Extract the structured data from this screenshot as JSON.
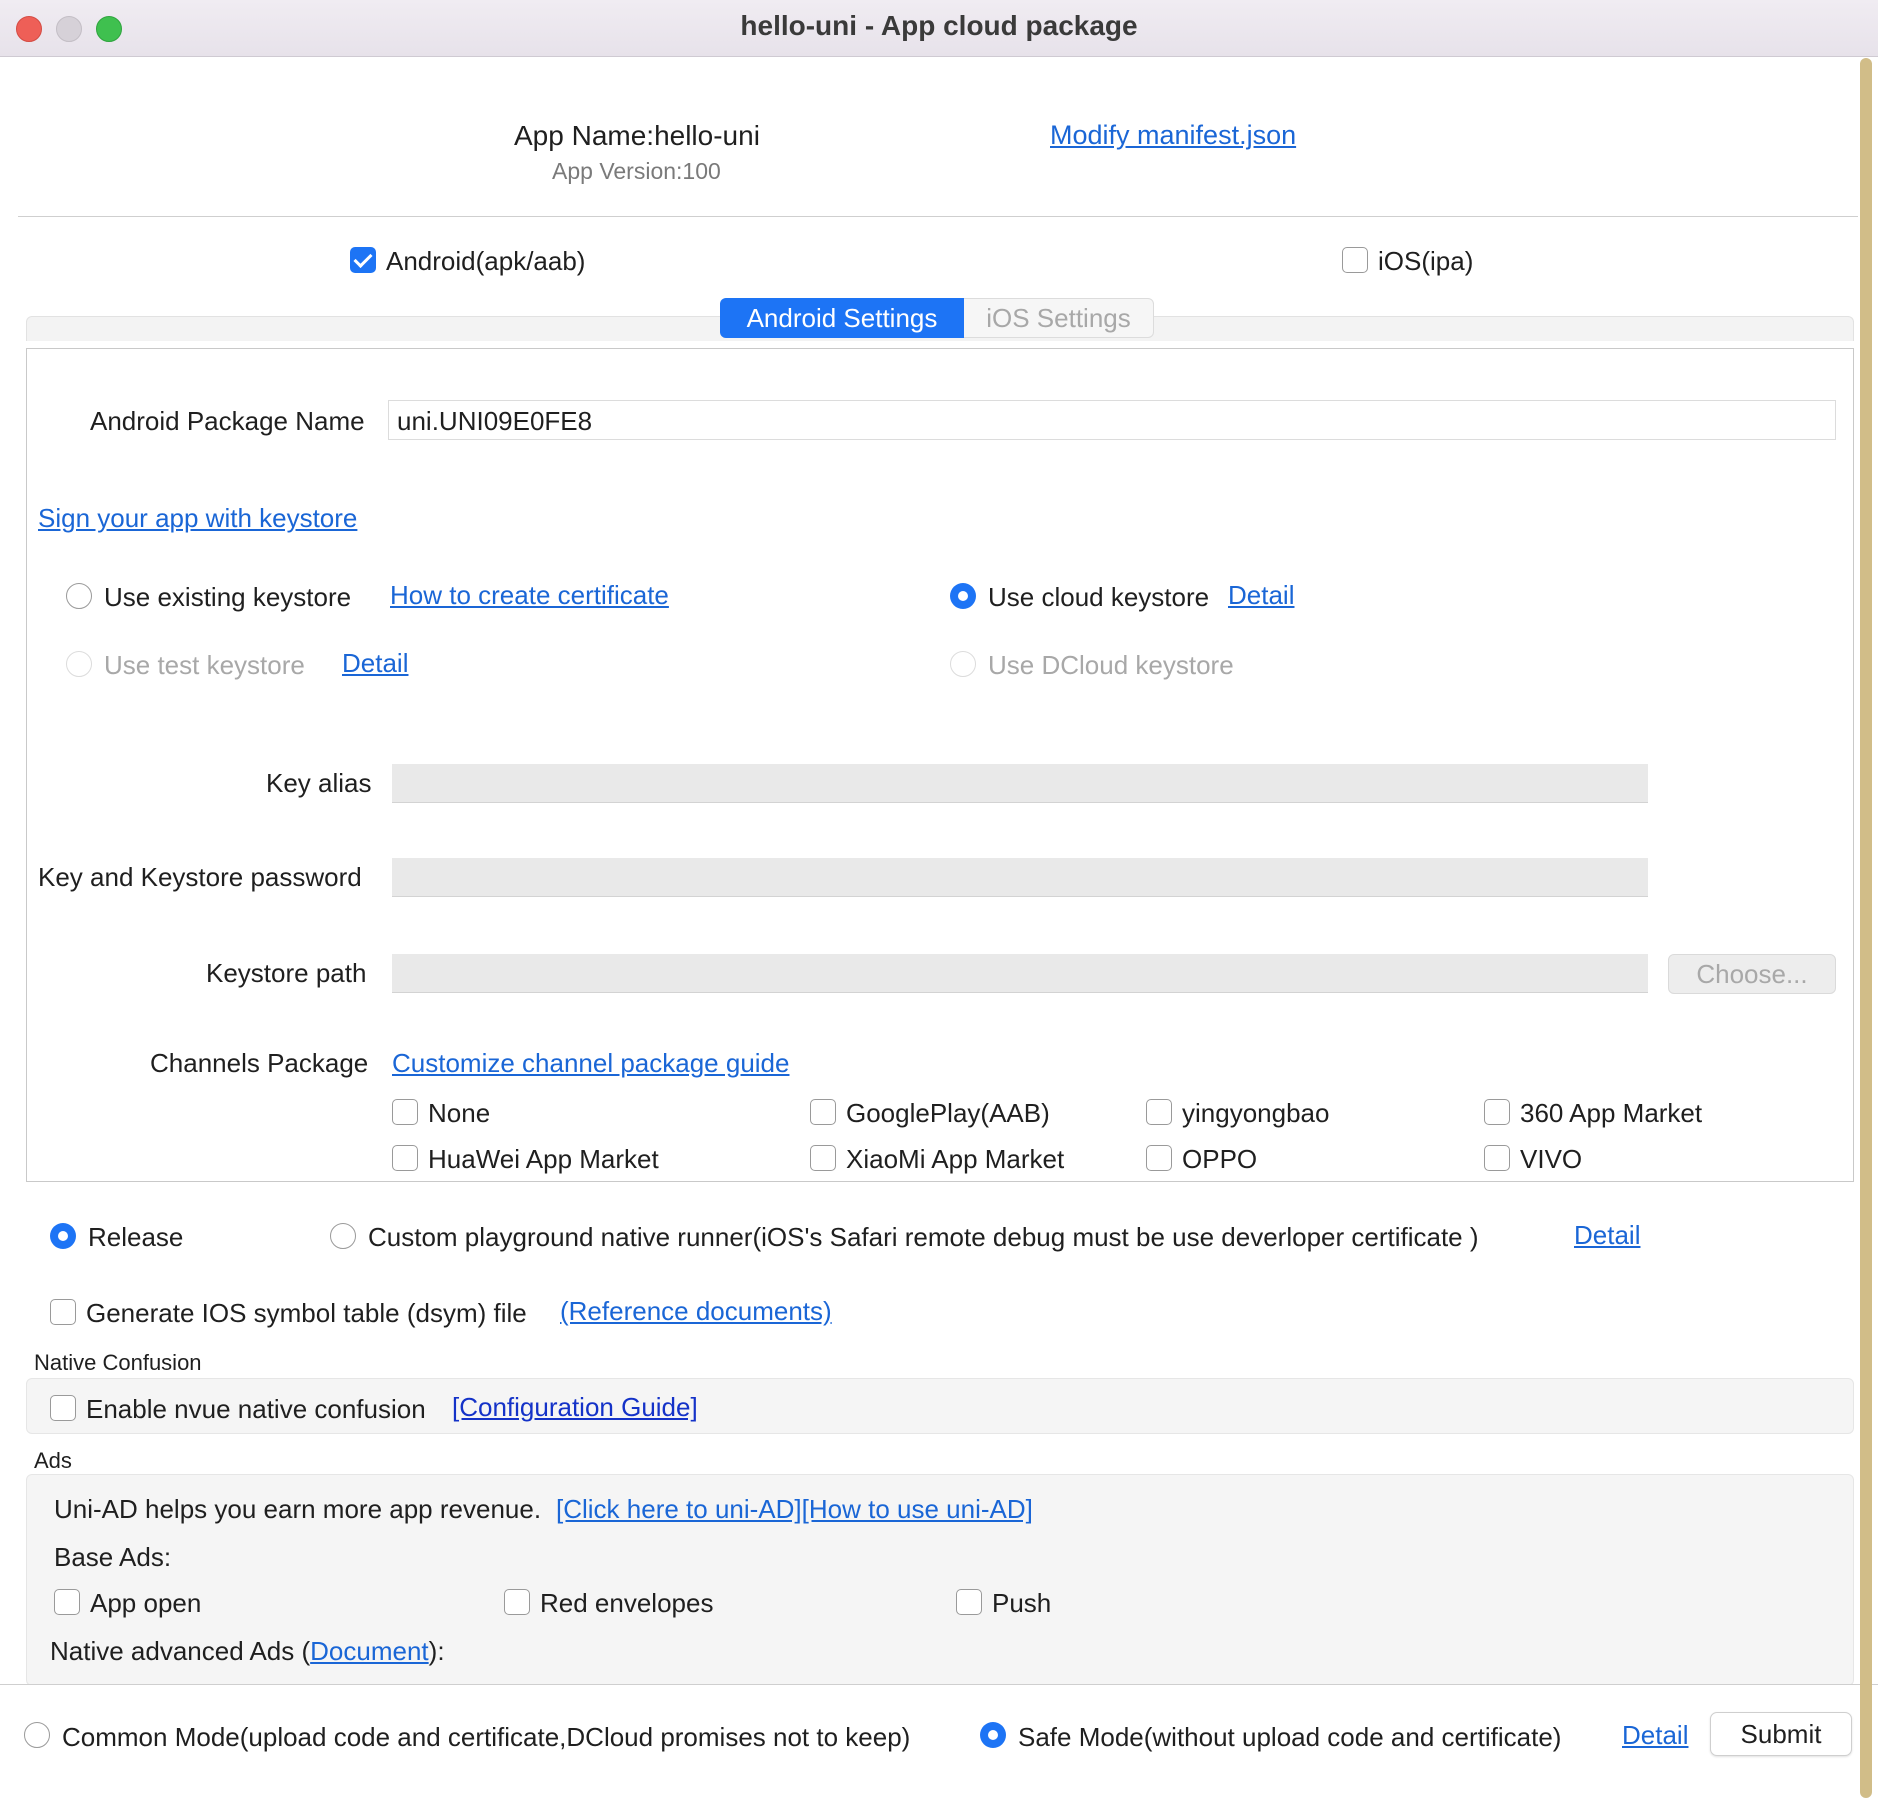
{
  "window": {
    "title": "hello-uni - App cloud package"
  },
  "app": {
    "name_label": "App Name:hello-uni",
    "version_label": "App Version:100",
    "modify_link": "Modify manifest.json"
  },
  "platforms": {
    "android_label": "Android(apk/aab)",
    "android_checked": true,
    "ios_label": "iOS(ipa)",
    "ios_checked": false
  },
  "tabs": {
    "android": "Android Settings",
    "ios": "iOS Settings",
    "active": "android"
  },
  "android": {
    "package_label": "Android Package Name",
    "package_value": "uni.UNI09E0FE8",
    "sign_link": "Sign your app with keystore",
    "keystore": {
      "existing": "Use existing keystore",
      "how_to_link": "How to create certificate",
      "cloud": "Use cloud keystore",
      "cloud_detail": "Detail",
      "test": "Use test keystore",
      "test_detail": "Detail",
      "dcloud": "Use DCloud keystore",
      "selected": "cloud"
    },
    "key_alias_label": "Key alias",
    "password_label": "Key and Keystore password",
    "path_label": "Keystore path",
    "choose_button": "Choose...",
    "channels_label": "Channels Package",
    "channels_link": "Customize channel package guide",
    "channels": [
      "None",
      "GooglePlay(AAB)",
      "yingyongbao",
      "360 App Market",
      "HuaWei App Market",
      "XiaoMi App Market",
      "OPPO",
      "VIVO"
    ]
  },
  "build": {
    "release": "Release",
    "custom_runner": "Custom playground native runner(iOS's  Safari remote debug must be use deverloper certificate )",
    "detail": "Detail",
    "selected": "release"
  },
  "dsym": {
    "label": "Generate IOS symbol table (dsym) file",
    "link": "(Reference documents)"
  },
  "native_confusion": {
    "heading": "Native Confusion",
    "label": "Enable nvue native confusion",
    "link": "[Configuration Guide]"
  },
  "ads": {
    "heading": "Ads",
    "intro": "Uni-AD helps you earn more app revenue.",
    "links": "[Click here to uni-AD][How to use uni-AD]",
    "base_label": "Base Ads:",
    "base_items": [
      "App open",
      "Red envelopes",
      "Push"
    ],
    "native_prefix": "Native advanced Ads (",
    "native_link": "Document",
    "native_suffix": "):"
  },
  "footer": {
    "common_mode": "Common Mode(upload code and certificate,DCloud promises not to keep)",
    "safe_mode": "Safe Mode(without upload code and certificate)",
    "detail": "Detail",
    "submit": "Submit",
    "selected": "safe"
  },
  "colors": {
    "accent": "#1d74f5",
    "link": "#1a66d6",
    "scrollbar": "#d1bd88"
  }
}
